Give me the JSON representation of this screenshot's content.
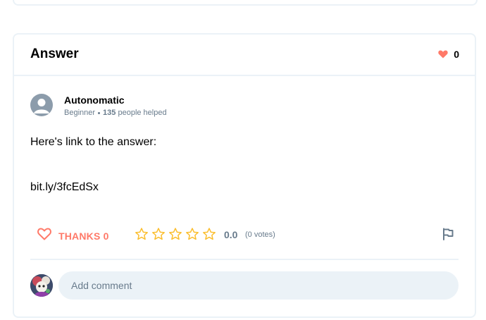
{
  "answer_card": {
    "title": "Answer",
    "likes_count": "0",
    "author": {
      "name": "Autonomatic",
      "rank": "Beginner",
      "helped_count": "135",
      "helped_suffix": "people helped"
    },
    "body": {
      "line1": "Here's link to the answer:",
      "line2": "bit.ly/3fcEdSx"
    },
    "actions": {
      "thanks_label": "THANKS 0",
      "rating_value": "0.0",
      "votes_label": "(0 votes)",
      "stars_total": 5,
      "stars_filled": 0
    },
    "comment": {
      "placeholder": "Add comment"
    }
  },
  "colors": {
    "accent_red": "#ff7968",
    "star_yellow": "#fbbe2e",
    "border": "#ebf2f7",
    "muted_text": "#687b8c",
    "flag_gray": "#687b8c"
  },
  "icons": [
    "heart-icon",
    "star-icon",
    "flag-icon",
    "user-placeholder-icon"
  ]
}
